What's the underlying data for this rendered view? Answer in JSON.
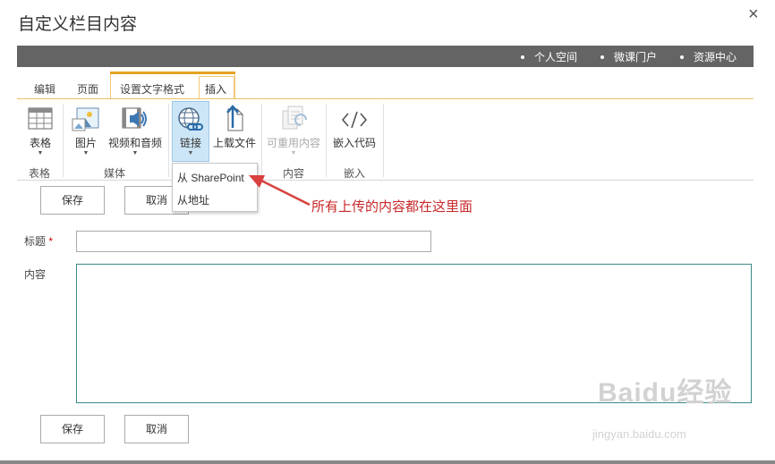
{
  "dialog": {
    "title": "自定义栏目内容",
    "close_icon": "×"
  },
  "topbar": {
    "links": [
      "个人空间",
      "微课门户",
      "资源中心"
    ]
  },
  "tabs": [
    "编辑",
    "页面",
    "设置文字格式",
    "插入"
  ],
  "ribbon": {
    "table": "表格",
    "image": "图片",
    "video": "视频和音频",
    "link": "链接",
    "upload": "上载文件",
    "reusable": "可重用内容",
    "embed": "嵌入代码",
    "groups": {
      "table": "表格",
      "media": "媒体",
      "content": "内容",
      "embed": "嵌入"
    }
  },
  "dropdown": {
    "from_sharepoint": "从 SharePoint",
    "from_address": "从地址"
  },
  "annotation": "所有上传的内容都在这里面",
  "form": {
    "title_label": "标题",
    "required_mark": "*",
    "content_label": "内容"
  },
  "buttons": {
    "save": "保存",
    "cancel": "取消"
  },
  "watermark": {
    "brand": "Baidu经验",
    "url": "jingyan.baidu.com"
  },
  "colors": {
    "topbar": "#646464",
    "ribbon_accent": "#e4a322",
    "annotation": "#c8282a",
    "link_selected": "#cde6f7"
  }
}
